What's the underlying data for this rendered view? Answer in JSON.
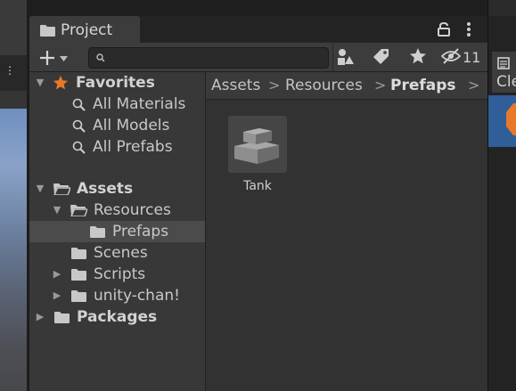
{
  "window": {
    "tab_label": "Project",
    "hidden_count": "11"
  },
  "toolbar": {
    "add_label": "+",
    "search_placeholder": ""
  },
  "tree": {
    "favorites": {
      "label": "Favorites",
      "items": [
        "All Materials",
        "All Models",
        "All Prefabs"
      ]
    },
    "assets": {
      "label": "Assets",
      "resources": "Resources",
      "prefabs": "Prefaps",
      "scenes": "Scenes",
      "scripts": "Scripts",
      "unitychan": "unity-chan!"
    },
    "packages": "Packages"
  },
  "breadcrumb": [
    "Assets",
    "Resources",
    "Prefaps"
  ],
  "assets_grid": [
    {
      "name": "Tank",
      "icon": "prefab-cube-icon"
    }
  ],
  "right_panel": {
    "label": "Cle"
  },
  "colors": {
    "star": "#e8782a",
    "selection_blue": "#2f5e99",
    "folder": "#c8c8c8"
  }
}
